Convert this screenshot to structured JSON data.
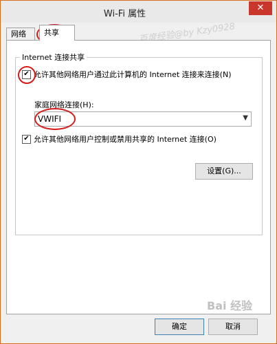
{
  "window": {
    "title": "Wi-Fi 属性",
    "close_glyph": "✕"
  },
  "tabs": [
    {
      "label": "网络"
    },
    {
      "label": "共享",
      "selected": true
    }
  ],
  "group": {
    "title": "Internet 连接共享",
    "allow_share": {
      "label": "允许其他网络用户通过此计算机的 Internet 连接来连接(N)",
      "checked": true
    },
    "home_network_label": "家庭网络连接(H):",
    "home_network_value": "VWIFI",
    "allow_control": {
      "label": "允许其他网络用户控制或禁用共享的 Internet 连接(O)",
      "checked": true
    },
    "settings_button": "设置(G)..."
  },
  "footer": {
    "ok_label": "确定",
    "cancel_label": "取消"
  },
  "watermark": {
    "top": "百度经验@by Kzy0928",
    "bottom": "Bai 经验"
  },
  "colors": {
    "annotation": "#d61a1a",
    "frame": "#d86b1a",
    "close": "#c9372c"
  }
}
